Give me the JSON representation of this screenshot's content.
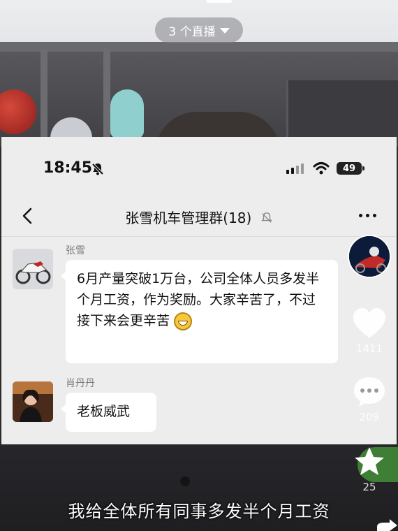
{
  "live_selector": {
    "label": "3 个直播"
  },
  "phone": {
    "status_bar": {
      "time": "18:45",
      "battery": "49"
    },
    "chat": {
      "title": "张雪机车管理群(18)",
      "messages": [
        {
          "sender": "张雪",
          "text": "6月产量突破1万台，公司全体人员多发半个月工资，作为奖励。大家辛苦了，不过接下来会更辛苦",
          "emoji": "grinning-face"
        },
        {
          "sender": "肖丹丹",
          "text": "老板威武"
        }
      ]
    }
  },
  "rail": {
    "likes": "1411",
    "comments": "209",
    "favorites": "25"
  },
  "caption": "我给全体所有同事多发半个月工资"
}
